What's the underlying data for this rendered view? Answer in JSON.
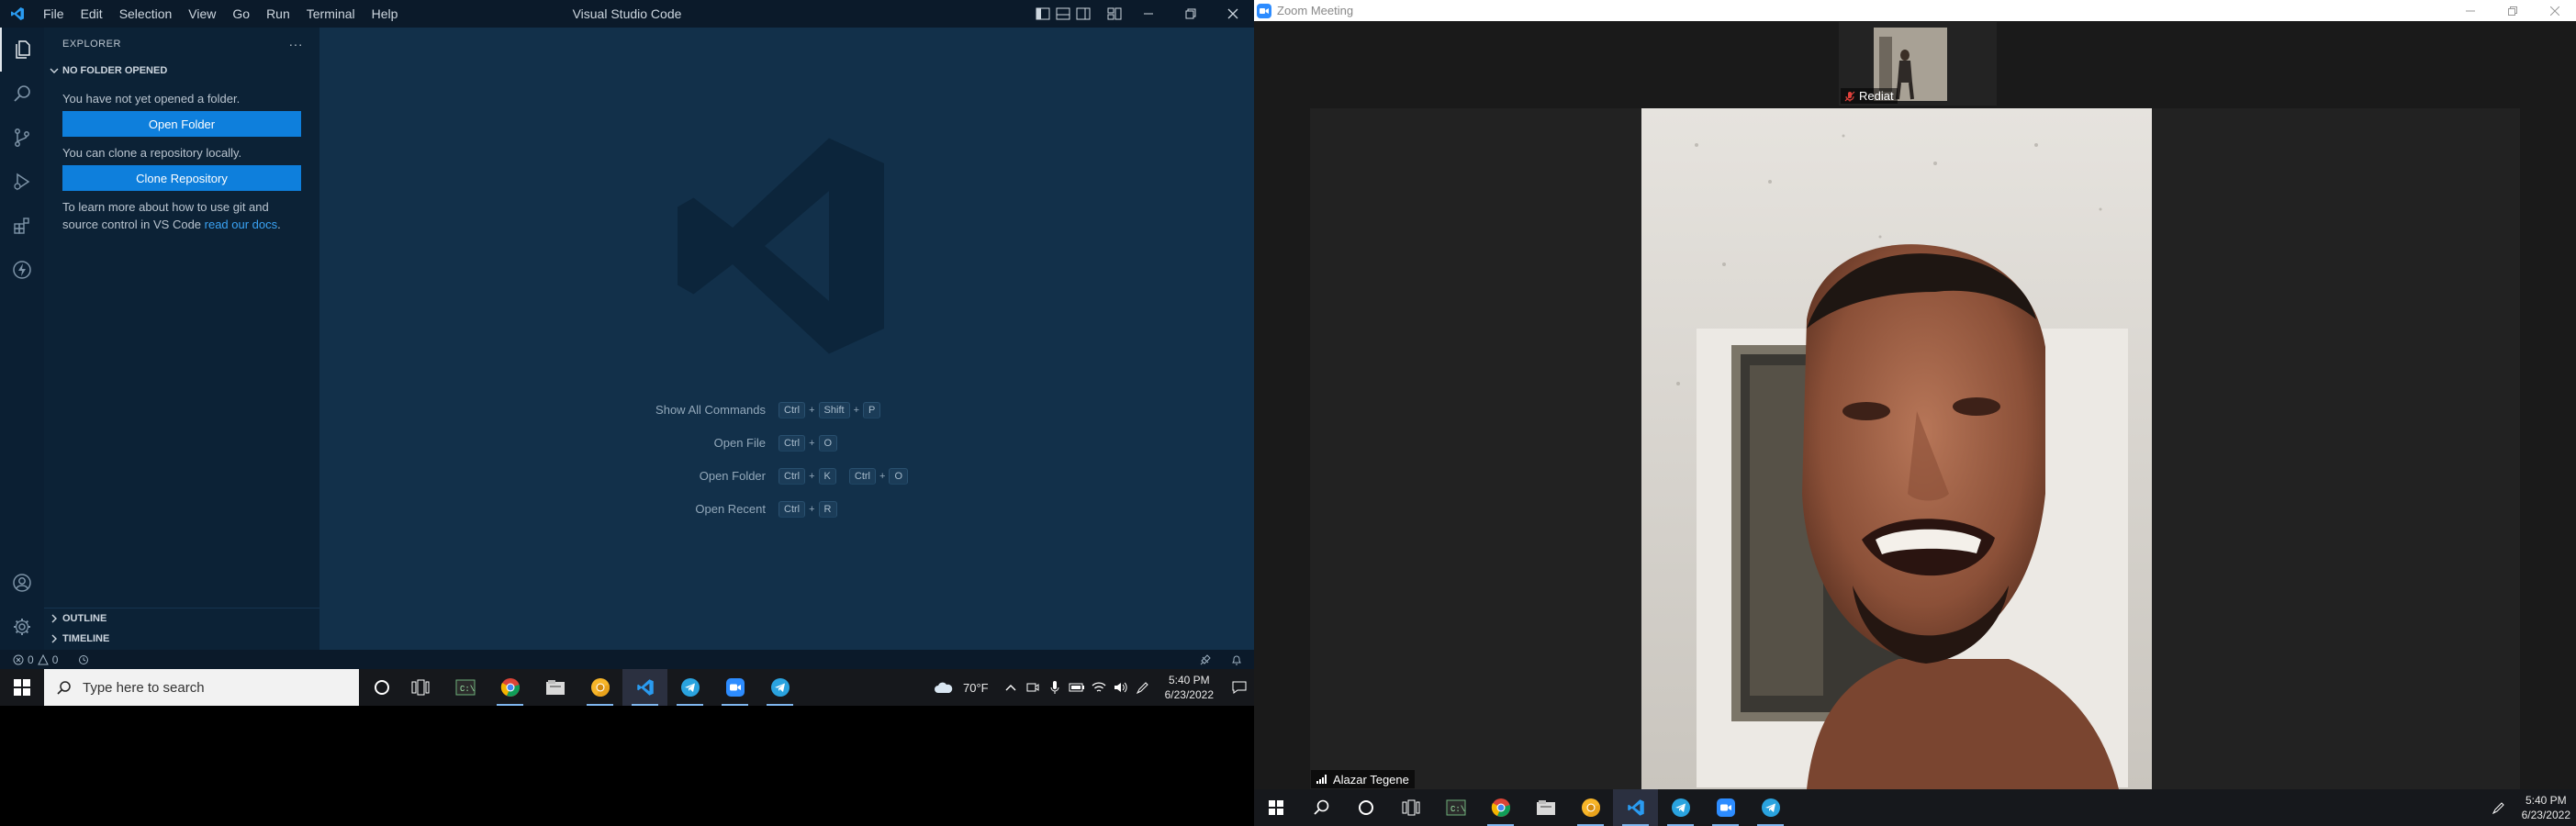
{
  "vscode": {
    "menu": [
      "File",
      "Edit",
      "Selection",
      "View",
      "Go",
      "Run",
      "Terminal",
      "Help"
    ],
    "title": "Visual Studio Code",
    "sidebar": {
      "header": "EXPLORER",
      "more": "···",
      "section_title": "NO FOLDER OPENED",
      "no_folder_text": "You have not yet opened a folder.",
      "open_folder_button": "Open Folder",
      "clone_text": "You can clone a repository locally.",
      "clone_button": "Clone Repository",
      "learn_text": "To learn more about how to use git and source control in VS Code ",
      "learn_link": "read our docs",
      "learn_end": ".",
      "outline": "OUTLINE",
      "timeline": "TIMELINE"
    },
    "shortcuts": [
      {
        "label": "Show All Commands",
        "keys": [
          [
            "Ctrl",
            "Shift",
            "P"
          ]
        ]
      },
      {
        "label": "Open File",
        "keys": [
          [
            "Ctrl",
            "O"
          ]
        ]
      },
      {
        "label": "Open Folder",
        "keys": [
          [
            "Ctrl",
            "K"
          ],
          [
            "Ctrl",
            "O"
          ]
        ]
      },
      {
        "label": "Open Recent",
        "keys": [
          [
            "Ctrl",
            "R"
          ]
        ]
      }
    ],
    "status": {
      "errors": "0",
      "warnings": "0"
    }
  },
  "taskbar_left": {
    "search_placeholder": "Type here to search",
    "weather": "70°F",
    "time": "5:40 PM",
    "date": "6/23/2022"
  },
  "zoom": {
    "title": "Zoom Meeting",
    "thumb_name": "Rediat",
    "speaker_name": "Alazar Tegene"
  },
  "taskbar_right": {
    "time": "5:40 PM",
    "date": "6/23/2022"
  },
  "colors": {
    "vscode_accent": "#0e7fdc",
    "zoom_blue": "#2d8cff"
  }
}
